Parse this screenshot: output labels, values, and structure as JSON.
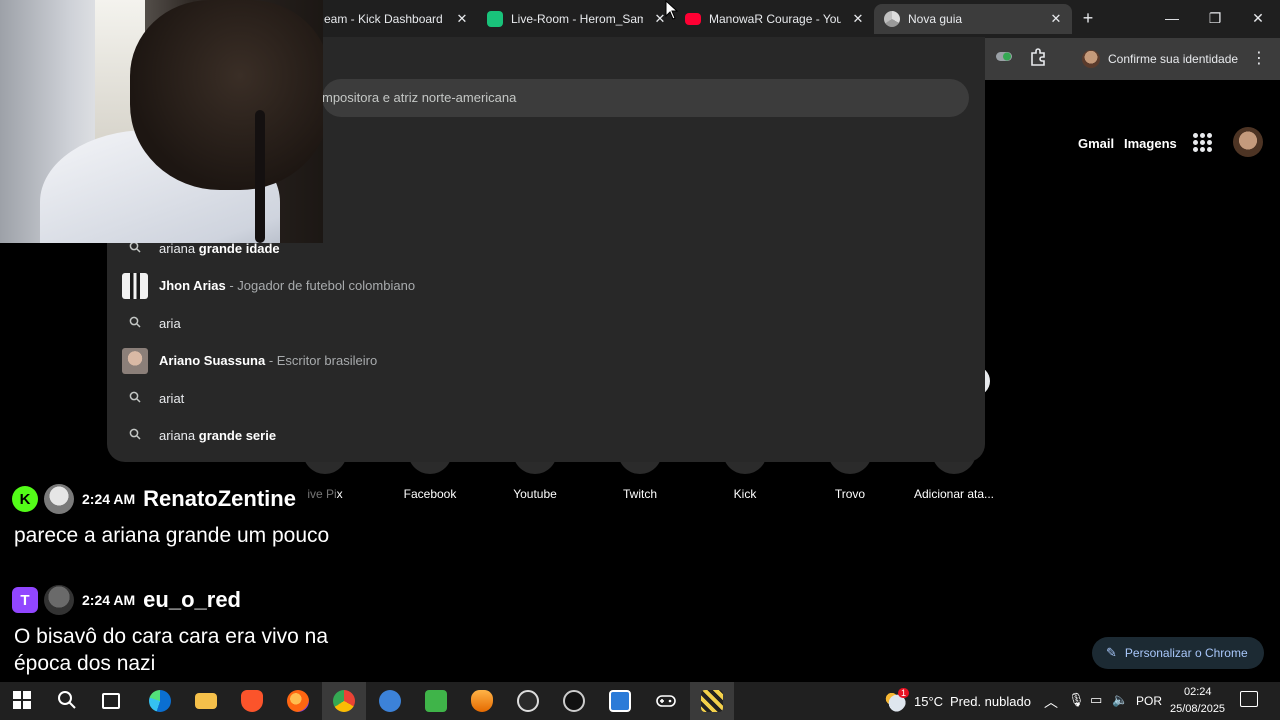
{
  "tabs": [
    {
      "label": "eam - Kick Dashboard",
      "favicon": "none",
      "active": false
    },
    {
      "label": "Live-Room - Herom_Samu",
      "favicon": "green-puzzle-icon",
      "active": false
    },
    {
      "label": "ManowaR Courage - YouTu",
      "favicon": "youtube-icon",
      "active": false
    },
    {
      "label": "Nova guia",
      "favicon": "chrome-icon",
      "active": true
    }
  ],
  "toolbar": {
    "profile_label": "Confirme sua identidade"
  },
  "omnibox": {
    "input_text": "mpositora e atriz norte-americana",
    "suggestions": [
      {
        "type": "search",
        "typed": "ariana",
        "rest": " grande idade",
        "desc": ""
      },
      {
        "type": "entity",
        "typed": "Jhon Arias",
        "rest": "",
        "desc": " - Jogador de futebol colombiano"
      },
      {
        "type": "search",
        "typed": "aria",
        "rest": "",
        "desc": ""
      },
      {
        "type": "entity",
        "typed": "Ariano Suassuna",
        "rest": "",
        "desc": " - Escritor brasileiro"
      },
      {
        "type": "search",
        "typed": "ariat",
        "rest": "",
        "desc": ""
      },
      {
        "type": "search",
        "typed": "ariana",
        "rest": " grande serie",
        "desc": ""
      }
    ]
  },
  "google": {
    "gmail": "Gmail",
    "images": "Imagens"
  },
  "shortcuts": [
    {
      "label": "ive Pix",
      "color": "#1a3b34"
    },
    {
      "label": "Facebook",
      "color": "#1877f2"
    },
    {
      "label": "Youtube",
      "color": "#ff0000"
    },
    {
      "label": "Twitch",
      "color": "#9146ff"
    },
    {
      "label": "Kick",
      "color": "#53fc18"
    },
    {
      "label": "Trovo",
      "color": "#19d66b"
    },
    {
      "label": "Adicionar ata...",
      "color": "#2b2b2b"
    }
  ],
  "customize_label": "Personalizar o Chrome",
  "chat": [
    {
      "platform": "K",
      "platform_name": "kick",
      "time": "2:24 AM",
      "user": "RenatoZentine",
      "message": "parece a ariana grande um pouco"
    },
    {
      "platform": "T",
      "platform_name": "twitch",
      "time": "2:24 AM",
      "user": "eu_o_red",
      "message": "O bisavô do cara cara era vivo na época dos nazi"
    }
  ],
  "taskbar": {
    "weather_temp": "15°C",
    "weather_desc": "Pred. nublado",
    "weather_badge": "1",
    "lang": "POR",
    "time": "02:24",
    "date": "25/08/2025"
  },
  "colors": {
    "accent_blue": "#a8c7fa",
    "kick_green": "#53fc18",
    "twitch_purple": "#9146ff"
  }
}
